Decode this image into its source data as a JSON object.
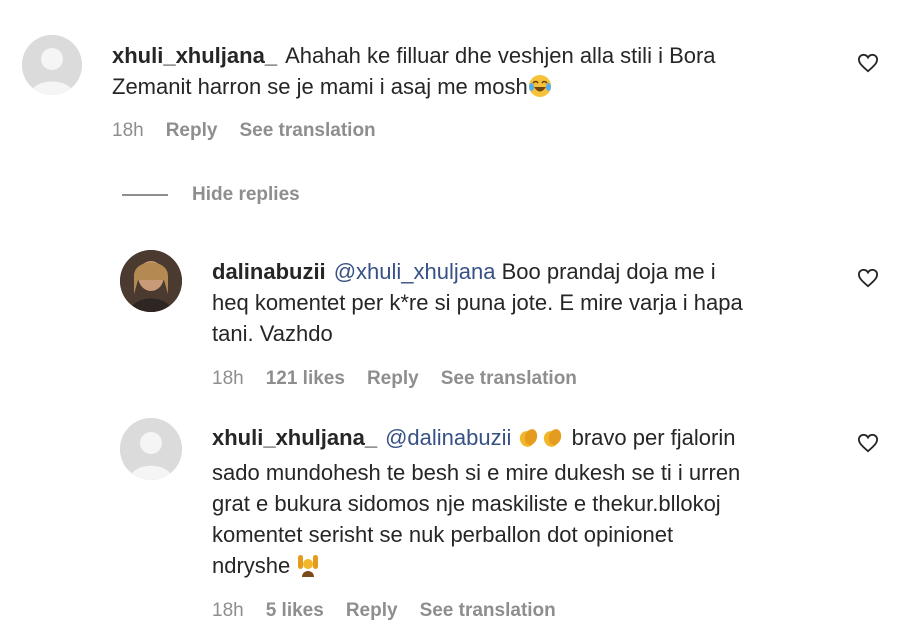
{
  "comments": [
    {
      "username": "xhuli_xhuljana_",
      "text": "Ahahah ke filluar dhe veshjen alla stili i Bora Zemanit harron se je mami i asaj me mosh",
      "emoji": "laughing-crying-emoji",
      "time": "18h",
      "reply_label": "Reply",
      "translation_label": "See translation"
    },
    {
      "username": "dalinabuzii",
      "mention": "@xhuli_xhuljana",
      "text": "Boo prandaj doja me i heq komentet per k*re si puna jote. E mire varja i hapa tani. Vazhdo",
      "time": "18h",
      "likes": "121 likes",
      "reply_label": "Reply",
      "translation_label": "See translation"
    },
    {
      "username": "xhuli_xhuljana_",
      "mention": "@dalinabuzii",
      "text": "bravo per fjalorin sado mundohesh te besh si e mire dukesh se ti i urren grat e bukura sidomos nje maskiliste e thekur.bllokoj komentet serisht se nuk perballon dot opinionet ndryshe",
      "emojis": [
        "clapping-hands-emoji",
        "clapping-hands-emoji",
        "person-raising-hands-emoji"
      ],
      "time": "18h",
      "likes": "5 likes",
      "reply_label": "Reply",
      "translation_label": "See translation"
    }
  ],
  "hide_replies_label": "Hide replies",
  "icons": {
    "like": "heart-outline-icon",
    "avatar_default": "default-avatar-icon"
  },
  "colors": {
    "text": "#262626",
    "secondary": "#8e8e8e",
    "mention": "#385185"
  },
  "text_lines": {
    "c1_l1_rest": "Ahahah ke filluar dhe veshjen alla stili i Bora",
    "c1_l2": "Zemanit harron se je mami i asaj me mosh",
    "c2_l1_rest": "Boo prandaj doja me i",
    "c2_l2": "heq komentet per k*re si puna jote. E mire varja i hapa",
    "c2_l3": "tani. Vazhdo",
    "c3_l1_rest": "bravo per fjalorin",
    "c3_l2": "sado mundohesh te besh si e mire dukesh se ti i urren",
    "c3_l3": "grat e bukura sidomos nje maskiliste e thekur.bllokoj",
    "c3_l4": "komentet serisht se nuk perballon dot opinionet",
    "c3_l5": "ndryshe"
  }
}
